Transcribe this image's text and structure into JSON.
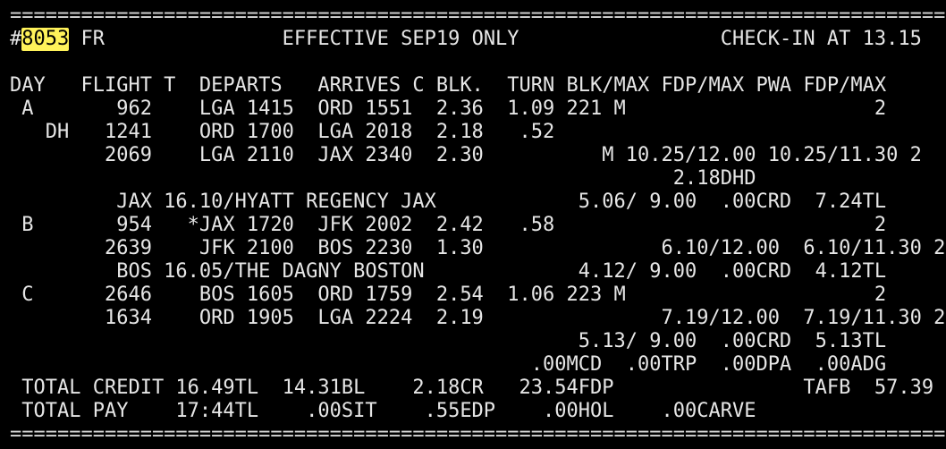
{
  "screen": {
    "separator_top": "================================================================================",
    "header": {
      "prefix": "#",
      "pairing_number": "8053",
      "rest": " FR               EFFECTIVE SEP19 ONLY                 CHECK-IN AT 13.15"
    },
    "lines": [
      "DAY   FLIGHT T  DEPARTS   ARRIVES C BLK.  TURN BLK/MAX FDP/MAX PWA FDP/MAX",
      " A       962    LGA 1415  ORD 1551  2.36  1.09 221 M                     2",
      "   DH   1241    ORD 1700  LGA 2018  2.18   .52",
      "        2069    LGA 2110  JAX 2340  2.30          M 10.25/12.00 10.25/11.30 2",
      "                                                        2.18DHD",
      "         JAX 16.10/HYATT REGENCY JAX            5.06/ 9.00  .00CRD  7.24TL",
      " B       954   *JAX 1720  JFK 2002  2.42   .58                           2",
      "        2639    JFK 2100  BOS 2230  1.30               6.10/12.00  6.10/11.30 2",
      "         BOS 16.05/THE DAGNY BOSTON             4.12/ 9.00  .00CRD  4.12TL",
      " C      2646    BOS 1605  ORD 1759  2.54  1.06 223 M                     2",
      "        1634    ORD 1905  LGA 2224  2.19               7.19/12.00  7.19/11.30 2",
      "                                                5.13/ 9.00  .00CRD  5.13TL",
      "                                            .00MCD  .00TRP  .00DPA  .00ADG",
      " TOTAL CREDIT 16.49TL  14.31BL    2.18CR   23.54FDP                TAFB  57.39",
      " TOTAL PAY    17:44TL    .00SIT    .55EDP    .00HOL    .00CARVE"
    ],
    "separator_bottom": "================================================================================"
  }
}
